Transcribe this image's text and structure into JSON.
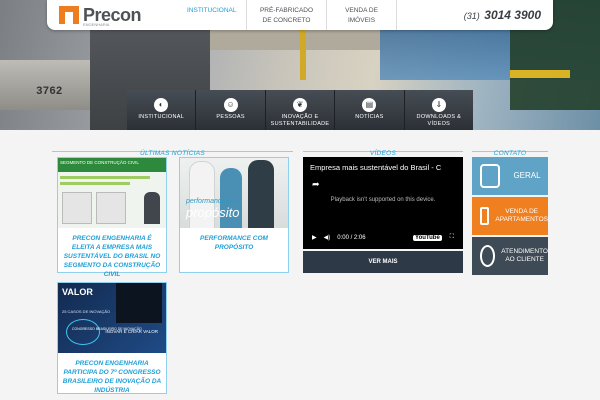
{
  "header": {
    "logo_text": "Precon",
    "logo_sub": "ENGENHARIA",
    "nav": [
      {
        "label": "INSTITUCIONAL",
        "active": true
      },
      {
        "label": "PRÉ-FABRICADO DE CONCRETO",
        "active": false
      },
      {
        "label": "VENDA DE IMÓVEIS",
        "active": false
      }
    ],
    "phone_ddd": "(31)",
    "phone_number": "3014 3900"
  },
  "hero": {
    "plate_text": "3762"
  },
  "iconbar": [
    {
      "label": "INSTITUCIONAL",
      "icon": "building-icon",
      "glyph": "◐"
    },
    {
      "label": "PESSOAS",
      "icon": "people-icon",
      "glyph": "☺"
    },
    {
      "label": "INOVAÇÃO E SUSTENTABILIDADE",
      "icon": "leaf-icon",
      "glyph": "❦"
    },
    {
      "label": "NOTÍCIAS",
      "icon": "news-icon",
      "glyph": "▤"
    },
    {
      "label": "DOWNLOADS & VÍDEOS",
      "icon": "download-icon",
      "glyph": "⇓"
    }
  ],
  "sections": {
    "news": "ÚLTIMAS NOTÍCIAS",
    "videos": "VÍDEOS",
    "contact": "CONTATO"
  },
  "news": [
    {
      "caption": "PRECON ENGENHARIA É ELEITA A EMPRESA MAIS SUSTENTÁVEL DO BRASIL NO SEGMENTO DA CONSTRUÇÃO CIVIL",
      "thumb_text": "SEGMENTO DE CONSTRUÇÃO CIVIL"
    },
    {
      "caption": "PERFORMANCE COM PROPÓSITO",
      "thumb_small": "performance com",
      "thumb_big": "propósito"
    },
    {
      "caption": "PRECON ENGENHARIA PARTICIPA DO 7º CONGRESSO BRASILEIRO DE INOVAÇÃO DA INDÚSTRIA",
      "thumb_title": "VALOR",
      "thumb_sub": "25 CASOS DE INOVAÇÃO",
      "thumb_circle": "CONGRESSO BRASILEIRO DE INOVAÇÃO",
      "thumb_right": "INOVAR É CRIAR VALOR"
    }
  ],
  "video": {
    "title": "Empresa mais sustentável do Brasil - C",
    "message": "Playback isn't supported on this device.",
    "time": "0:00 / 2:06",
    "brand": "YouTube",
    "more": "VER MAIS"
  },
  "contact": [
    {
      "label": "GERAL",
      "icon": "phone-icon"
    },
    {
      "label": "VENDA DE APARTAMENTOS",
      "icon": "house-icon"
    },
    {
      "label": "ATENDIMENTO AO CLIENTE",
      "icon": "headset-icon"
    }
  ],
  "colors": {
    "accent": "#1e9fd8",
    "brand_orange": "#ee7d1f",
    "contact_blue": "#5fa4c7",
    "contact_orange": "#ef7f1f",
    "contact_dark": "#3e4a55"
  }
}
